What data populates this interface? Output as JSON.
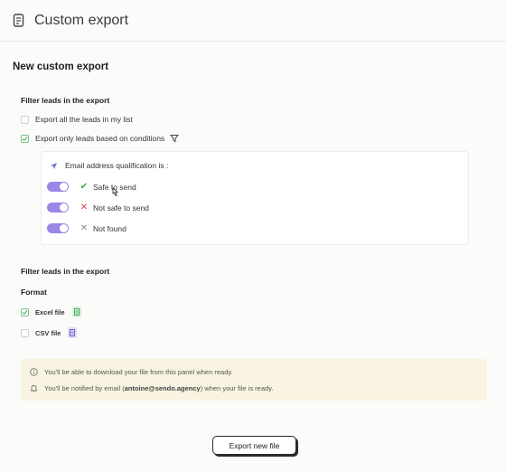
{
  "header": {
    "title": "Custom export",
    "icon": "document-icon"
  },
  "main": {
    "title": "New custom export",
    "filter_section_1": {
      "heading": "Filter leads in the export",
      "options": [
        {
          "label": "Export all the leads in my list",
          "checked": false
        },
        {
          "label": "Export only leads based on conditions",
          "checked": true
        }
      ]
    },
    "conditions": {
      "heading": "Email address qualification is :",
      "items": [
        {
          "label": "Safe to send",
          "enabled": true,
          "mark": "check-icon"
        },
        {
          "label": "Not safe to send",
          "enabled": true,
          "mark": "x-icon"
        },
        {
          "label": "Not found",
          "enabled": true,
          "mark": "x-icon"
        }
      ]
    },
    "filter_section_2": {
      "heading": "Filter leads in the export"
    },
    "format": {
      "heading": "Format",
      "files": [
        {
          "label": "Excel file",
          "checked": true,
          "icon": "excel-file-icon"
        },
        {
          "label": "CSV file",
          "checked": false,
          "icon": "csv-file-icon"
        }
      ]
    },
    "info": {
      "line1": "You'll be able to download your file from this panel when ready.",
      "line2_prefix": "You'll be notified by email (",
      "line2_email": "antoine@sendo.agency",
      "line2_suffix": ") when your file is ready."
    },
    "export_button": "Export new file"
  },
  "colors": {
    "accent_toggle": "#9c86e6",
    "success": "#38a44e",
    "danger": "#d9394a",
    "info_bg": "#f8f4e1"
  }
}
